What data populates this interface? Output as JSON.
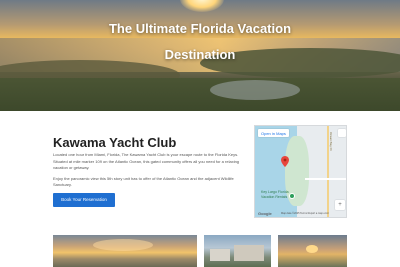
{
  "hero": {
    "title_line1": "The Ultimate Florida Vacation",
    "title_line2": "Destination"
  },
  "main": {
    "title": "Kawama Yacht Club",
    "paragraph1": "Located one hour from Miami, Florida, The Kawama Yacht Club is your escape route to the Florida Keys. Situated at mile marker 109 on the Atlantic Ocean, this gated community offers all you need for a relaxing vacation or getaway.",
    "paragraph2": "Enjoy the panoramic view this 5th story unit has to offer of the Atlantic Ocean and the adjacent Wildlife Sanctuary.",
    "book_button": "Book Your Reservation"
  },
  "map": {
    "open_link": "Open in Maps",
    "place_label": "Key Largo Florida Vacation Rentals",
    "road_label": "Ocean Bay Dr",
    "google": "Google",
    "footer": "Map data ©2025  Terms  Report a map error",
    "zoom": "+"
  },
  "colors": {
    "button": "#1f6fd1",
    "title": "#222222"
  }
}
